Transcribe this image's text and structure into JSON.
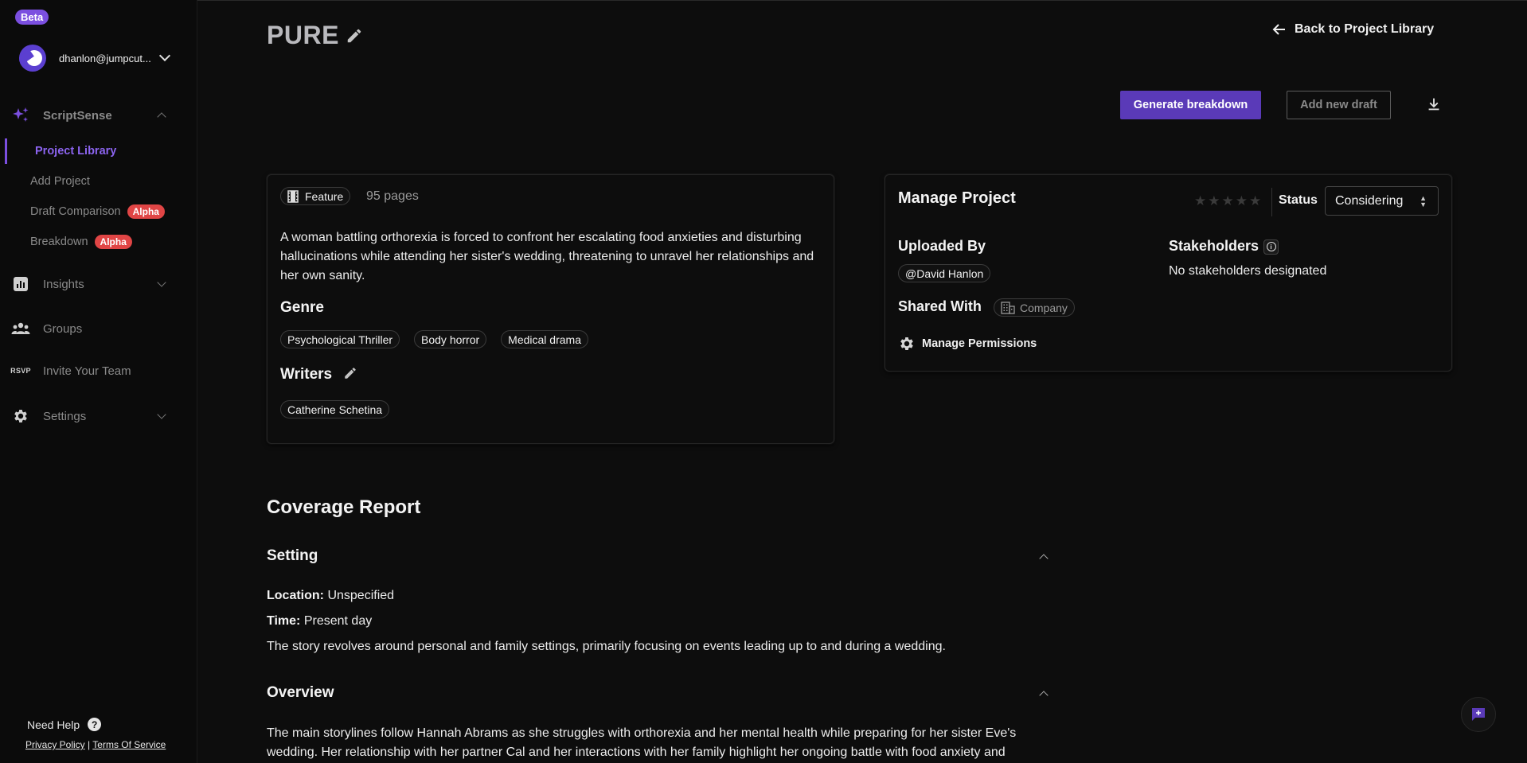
{
  "sidebar": {
    "beta_badge": "Beta",
    "user_email": "dhanlon@jumpcut...",
    "sections": [
      {
        "label": "ScriptSense"
      },
      {
        "label": "Insights"
      },
      {
        "label": "Groups"
      },
      {
        "label": "Invite Your Team"
      },
      {
        "label": "Settings"
      }
    ],
    "rsvp_icon_text": "RSVP",
    "subitems": [
      {
        "label": "Project Library",
        "active": true
      },
      {
        "label": "Add Project"
      },
      {
        "label": "Draft Comparison",
        "badge": "Alpha"
      },
      {
        "label": "Breakdown",
        "badge": "Alpha"
      }
    ],
    "help_label": "Need Help",
    "help_icon_text": "?",
    "privacy_label": "Privacy Policy",
    "legal_separator": "|",
    "terms_label": "Terms Of Service"
  },
  "header": {
    "title": "PURE",
    "back_label": "Back to Project Library"
  },
  "actions": {
    "generate_label": "Generate breakdown",
    "add_draft_label": "Add new draft"
  },
  "summary": {
    "format": "Feature",
    "pages": "95 pages",
    "logline": "A woman battling orthorexia is forced to confront her escalating food anxieties and disturbing hallucinations while attending her sister's wedding, threatening to unravel her relationships and her own sanity.",
    "genre_heading": "Genre",
    "genres": [
      "Psychological Thriller",
      "Body horror",
      "Medical drama"
    ],
    "writers_heading": "Writers",
    "writers": [
      "Catherine Schetina"
    ]
  },
  "manage": {
    "title": "Manage Project",
    "rating": 0,
    "rating_max": 5,
    "status_label": "Status",
    "status_value": "Considering",
    "uploaded_by_heading": "Uploaded By",
    "uploader": "@David Hanlon",
    "stakeholders_heading": "Stakeholders",
    "info_icon_text": "i",
    "stakeholders_empty": "No stakeholders designated",
    "shared_with_heading": "Shared With",
    "shared_with": "Company",
    "permissions_label": "Manage Permissions"
  },
  "coverage": {
    "title": "Coverage Report",
    "setting_heading": "Setting",
    "location_label": "Location:",
    "location_value": "Unspecified",
    "time_label": "Time:",
    "time_value": "Present day",
    "setting_text": "The story revolves around personal and family settings, primarily focusing on events leading up to and during a wedding.",
    "overview_heading": "Overview",
    "overview_text": "The main storylines follow Hannah Abrams as she struggles with orthorexia and her mental health while preparing for her sister Eve's wedding. Her relationship with her partner Cal and her interactions with her family highlight her ongoing battle with food anxiety and"
  },
  "colors": {
    "accent": "#7b4fe0",
    "primary_button": "#5a3ab8",
    "alpha_badge": "#e04545",
    "background": "#0d0d0d"
  }
}
